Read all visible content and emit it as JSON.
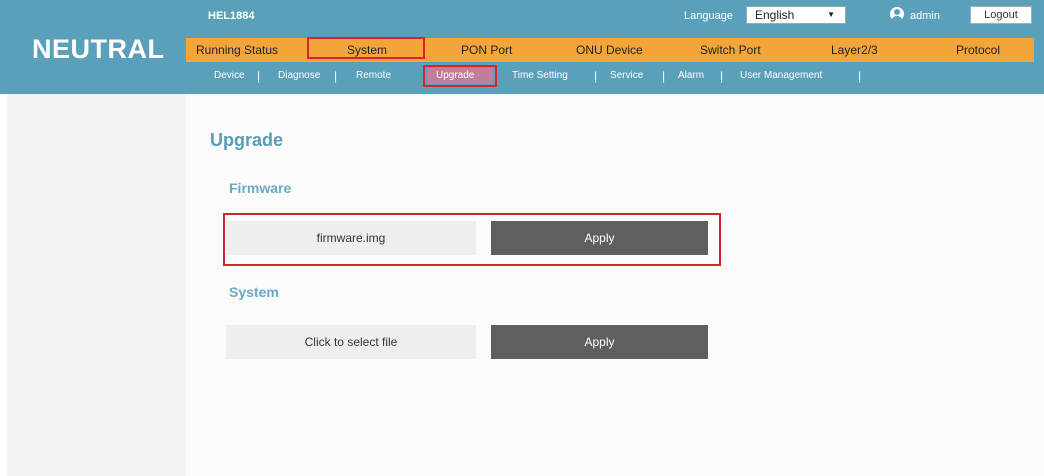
{
  "header": {
    "brand": "NEUTRAL",
    "model": "HEL1884",
    "language_label": "Language",
    "language_value": "English",
    "user": "admin",
    "logout_label": "Logout"
  },
  "main_nav": {
    "items": [
      "Running Status",
      "System",
      "PON Port",
      "ONU Device",
      "Switch Port",
      "Layer2/3",
      "Protocol"
    ],
    "selected": "System"
  },
  "sub_nav": {
    "items": [
      "Device",
      "Diagnose",
      "Remote",
      "Upgrade",
      "Time Setting",
      "Service",
      "Alarm",
      "User Management"
    ],
    "selected": "Upgrade"
  },
  "page": {
    "title": "Upgrade",
    "firmware": {
      "title": "Firmware",
      "file_label": "firmware.img",
      "apply_label": "Apply"
    },
    "system": {
      "title": "System",
      "file_label": "Click to select file",
      "apply_label": "Apply"
    }
  },
  "colors": {
    "header_bg": "#5aa0bb",
    "nav_bg": "#f3a53a",
    "highlight_border": "#d8242a",
    "apply_bg": "#5f5f5f"
  }
}
